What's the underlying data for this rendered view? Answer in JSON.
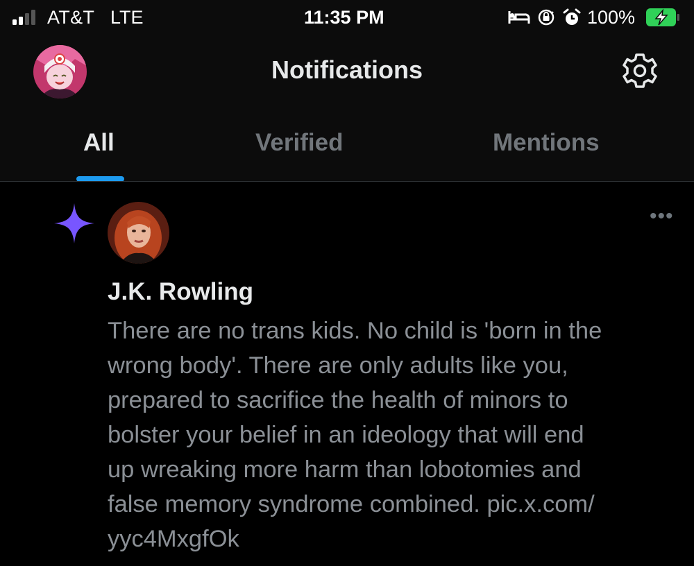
{
  "status_bar": {
    "carrier": "AT&T",
    "network": "LTE",
    "time": "11:35 PM",
    "battery_percent": "100%",
    "signal_bars_filled": 2,
    "signal_bars_total": 4,
    "icons": [
      "bed-icon",
      "orientation-lock-icon",
      "alarm-icon",
      "battery-charging-icon"
    ]
  },
  "header": {
    "title": "Notifications",
    "avatar_icon": "profile-avatar",
    "settings_icon": "gear-icon"
  },
  "tabs": [
    {
      "label": "All",
      "active": true
    },
    {
      "label": "Verified",
      "active": false
    },
    {
      "label": "Mentions",
      "active": false
    }
  ],
  "notification": {
    "type_icon": "sparkle-icon",
    "author": "J.K. Rowling",
    "more_icon": "more-horizontal-icon",
    "text_lines": [
      "There are no trans kids. No child is 'born in the",
      "wrong body'. There are only adults like you,",
      "prepared to sacrifice the health of minors to",
      "bolster your belief in an ideology that will end",
      "up wreaking more harm than lobotomies and",
      "false memory syndrome combined. pic.x.com/",
      "yyc4MxgfOk"
    ]
  },
  "colors": {
    "accent": "#1d9bf0",
    "sparkle": "#7856ff",
    "battery": "#30d158",
    "secondary_text": "#8b9096"
  }
}
